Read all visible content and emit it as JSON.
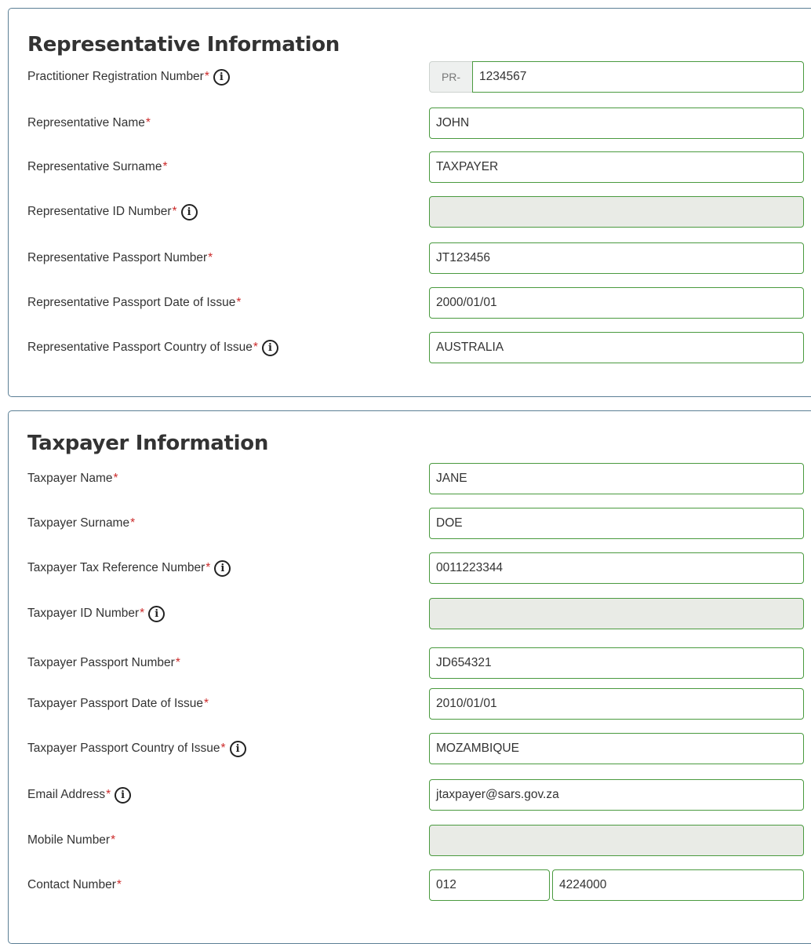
{
  "representative": {
    "title": "Representative Information",
    "required_mark": "*",
    "fields": [
      {
        "label": "Practitioner Registration Number",
        "prefix": "PR-",
        "value": "1234567",
        "info": true
      },
      {
        "label": "Representative Name",
        "value": "JOHN"
      },
      {
        "label": "Representative Surname",
        "value": "TAXPAYER"
      },
      {
        "label": "Representative ID Number",
        "value": "",
        "info": true,
        "disabled": true
      },
      {
        "label": "Representative Passport Number",
        "value": "JT123456"
      },
      {
        "label": "Representative Passport Date of Issue",
        "value": "2000/01/01"
      },
      {
        "label": "Representative Passport Country of Issue",
        "value": "AUSTRALIA",
        "info": true
      }
    ]
  },
  "taxpayer": {
    "title": "Taxpayer Information",
    "fields": [
      {
        "label": "Taxpayer Name",
        "value": "JANE"
      },
      {
        "label": "Taxpayer Surname",
        "value": "DOE"
      },
      {
        "label": "Taxpayer Tax Reference Number",
        "value": "0011223344",
        "info": true
      },
      {
        "label": "Taxpayer ID Number",
        "value": "",
        "info": true,
        "disabled": true
      },
      {
        "label": "Taxpayer Passport Number",
        "value": "JD654321"
      },
      {
        "label": "Taxpayer Passport Date of Issue",
        "value": "2010/01/01"
      },
      {
        "label": "Taxpayer Passport Country of Issue",
        "value": "MOZAMBIQUE",
        "info": true
      },
      {
        "label": "Email Address",
        "value": "jtaxpayer@sars.gov.za",
        "info": true
      },
      {
        "label": "Mobile Number",
        "value": "",
        "disabled": true
      },
      {
        "label": "Contact Number",
        "code": "012",
        "number": "4224000"
      }
    ]
  },
  "icons": {
    "info": "info-circle-icon",
    "info_glyph": "i"
  },
  "colors": {
    "field_border": "#4a9a3f",
    "required": "#cc2a2a",
    "panel_border": "#5b7f95",
    "disabled_bg": "#e9ebe6"
  }
}
